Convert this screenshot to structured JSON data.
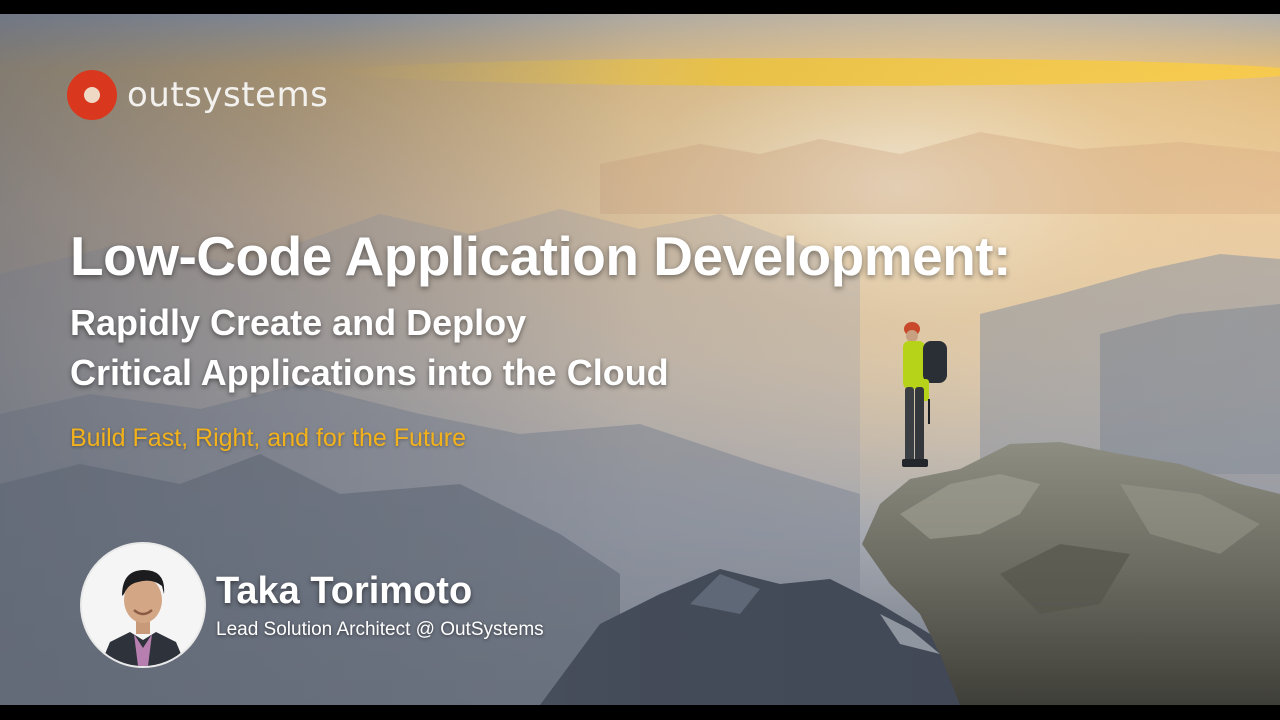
{
  "brand": {
    "logo_text": "outsystems",
    "logo_color": "#d9381e"
  },
  "slide": {
    "title": "Low-Code Application Development:",
    "subtitle_line1": "Rapidly Create and Deploy",
    "subtitle_line2": "Critical Applications into the Cloud",
    "tagline": "Build Fast, Right, and for the Future",
    "tagline_color": "#f3b21b"
  },
  "speaker": {
    "name": "Taka Torimoto",
    "role": "Lead Solution Architect  @ OutSystems"
  },
  "scene": {
    "background": "mountain-sunrise-landscape",
    "hiker_icon": "hiker-figure",
    "cliff_icon": "rock-cliff"
  }
}
